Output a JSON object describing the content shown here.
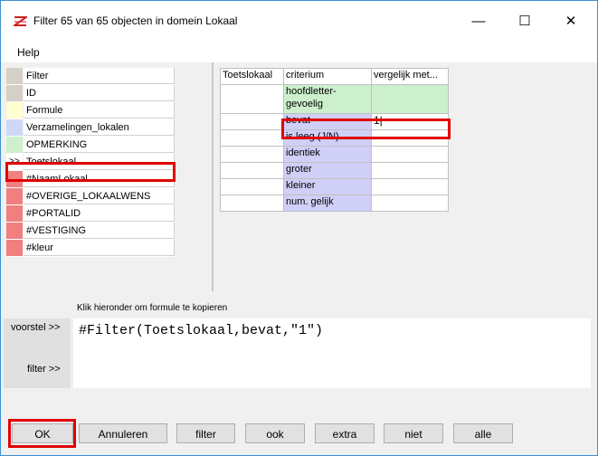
{
  "window": {
    "title": "Filter 65 van 65 objecten in domein Lokaal",
    "colors": {
      "accent_border": "#3c8fd6",
      "highlight": "#e00000"
    }
  },
  "menu": {
    "items": [
      "Help"
    ]
  },
  "filter_list": {
    "rows": [
      {
        "marker": "",
        "label": "Filter",
        "color": "#ffffff"
      },
      {
        "marker": "",
        "label": "ID",
        "color": "#ffffff"
      },
      {
        "marker": "",
        "label": "Formule",
        "color": "#ffffd0"
      },
      {
        "marker": "",
        "label": "Verzamelingen_lokalen",
        "color": "#d0d8f8"
      },
      {
        "marker": "",
        "label": "OPMERKING",
        "color": "#ccf0cc"
      },
      {
        "marker": ">>",
        "label": "Toetslokaal",
        "color": "#ffffff"
      },
      {
        "marker": "",
        "label": "#NaamLokaal",
        "color": "#f08080"
      },
      {
        "marker": "",
        "label": "#OVERIGE_LOKAALWENS",
        "color": "#f08080"
      },
      {
        "marker": "",
        "label": "#PORTALID",
        "color": "#f08080"
      },
      {
        "marker": "",
        "label": "#VESTIGING",
        "color": "#f08080"
      },
      {
        "marker": "",
        "label": "#kleur",
        "color": "#f08080"
      }
    ]
  },
  "criteria_grid": {
    "headers": [
      "Toetslokaal",
      "criterium",
      "vergelijk met..."
    ],
    "rows": [
      {
        "criterium": "hoofdletter-gevoelig",
        "value": ""
      },
      {
        "criterium": "bevat",
        "value": "1|"
      },
      {
        "criterium": "is leeg (J/N)",
        "value": ""
      },
      {
        "criterium": "identiek",
        "value": ""
      },
      {
        "criterium": "groter",
        "value": ""
      },
      {
        "criterium": "kleiner",
        "value": ""
      },
      {
        "criterium": "num. gelijk",
        "value": ""
      }
    ]
  },
  "formula": {
    "hint": "Klik hieronder om formule te kopieren",
    "voorstel_label": "voorstel >>",
    "filter_label": "filter >>",
    "voorstel_text": "#Filter(Toetslokaal,bevat,\"1\")"
  },
  "buttons": {
    "ok": "OK",
    "annuleren": "Annuleren",
    "filter": "filter",
    "ook": "ook",
    "extra": "extra",
    "niet": "niet",
    "alle": "alle"
  }
}
